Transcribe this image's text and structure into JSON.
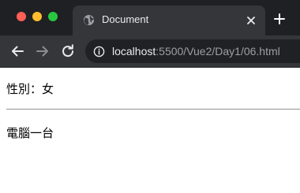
{
  "window": {
    "tab": {
      "title": "Document",
      "icon": "globe-icon"
    },
    "new_tab_icon": "plus-icon",
    "toolbar": {
      "back_icon": "back-arrow-icon",
      "forward_icon": "forward-arrow-icon",
      "reload_icon": "reload-icon",
      "site_info_icon": "info-icon",
      "url_host": "localhost",
      "url_path": ":5500/Vue2/Day1/06.html"
    }
  },
  "page": {
    "gender_label": "性別",
    "gender_separator": "：",
    "gender_value": "女",
    "item_text": "電腦一台"
  },
  "colors": {
    "tab_strip_bg": "#1f2023",
    "active_tab_bg": "#35363a",
    "omnibox_bg": "#202124",
    "close_red": "#ff5f57",
    "minimize_yellow": "#febc2e",
    "maximize_green": "#28c840"
  }
}
